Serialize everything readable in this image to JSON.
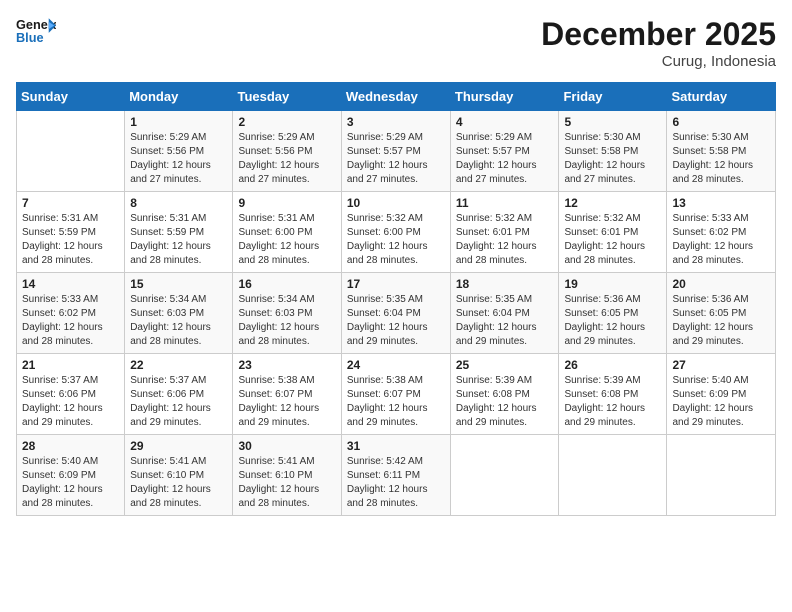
{
  "app": {
    "name": "GeneralBlue"
  },
  "header": {
    "month_year": "December 2025",
    "location": "Curug, Indonesia"
  },
  "calendar": {
    "weekdays": [
      "Sunday",
      "Monday",
      "Tuesday",
      "Wednesday",
      "Thursday",
      "Friday",
      "Saturday"
    ],
    "weeks": [
      [
        {
          "day": "",
          "content": ""
        },
        {
          "day": "1",
          "content": "Sunrise: 5:29 AM\nSunset: 5:56 PM\nDaylight: 12 hours\nand 27 minutes."
        },
        {
          "day": "2",
          "content": "Sunrise: 5:29 AM\nSunset: 5:56 PM\nDaylight: 12 hours\nand 27 minutes."
        },
        {
          "day": "3",
          "content": "Sunrise: 5:29 AM\nSunset: 5:57 PM\nDaylight: 12 hours\nand 27 minutes."
        },
        {
          "day": "4",
          "content": "Sunrise: 5:29 AM\nSunset: 5:57 PM\nDaylight: 12 hours\nand 27 minutes."
        },
        {
          "day": "5",
          "content": "Sunrise: 5:30 AM\nSunset: 5:58 PM\nDaylight: 12 hours\nand 27 minutes."
        },
        {
          "day": "6",
          "content": "Sunrise: 5:30 AM\nSunset: 5:58 PM\nDaylight: 12 hours\nand 28 minutes."
        }
      ],
      [
        {
          "day": "7",
          "content": "Sunrise: 5:31 AM\nSunset: 5:59 PM\nDaylight: 12 hours\nand 28 minutes."
        },
        {
          "day": "8",
          "content": "Sunrise: 5:31 AM\nSunset: 5:59 PM\nDaylight: 12 hours\nand 28 minutes."
        },
        {
          "day": "9",
          "content": "Sunrise: 5:31 AM\nSunset: 6:00 PM\nDaylight: 12 hours\nand 28 minutes."
        },
        {
          "day": "10",
          "content": "Sunrise: 5:32 AM\nSunset: 6:00 PM\nDaylight: 12 hours\nand 28 minutes."
        },
        {
          "day": "11",
          "content": "Sunrise: 5:32 AM\nSunset: 6:01 PM\nDaylight: 12 hours\nand 28 minutes."
        },
        {
          "day": "12",
          "content": "Sunrise: 5:32 AM\nSunset: 6:01 PM\nDaylight: 12 hours\nand 28 minutes."
        },
        {
          "day": "13",
          "content": "Sunrise: 5:33 AM\nSunset: 6:02 PM\nDaylight: 12 hours\nand 28 minutes."
        }
      ],
      [
        {
          "day": "14",
          "content": "Sunrise: 5:33 AM\nSunset: 6:02 PM\nDaylight: 12 hours\nand 28 minutes."
        },
        {
          "day": "15",
          "content": "Sunrise: 5:34 AM\nSunset: 6:03 PM\nDaylight: 12 hours\nand 28 minutes."
        },
        {
          "day": "16",
          "content": "Sunrise: 5:34 AM\nSunset: 6:03 PM\nDaylight: 12 hours\nand 28 minutes."
        },
        {
          "day": "17",
          "content": "Sunrise: 5:35 AM\nSunset: 6:04 PM\nDaylight: 12 hours\nand 29 minutes."
        },
        {
          "day": "18",
          "content": "Sunrise: 5:35 AM\nSunset: 6:04 PM\nDaylight: 12 hours\nand 29 minutes."
        },
        {
          "day": "19",
          "content": "Sunrise: 5:36 AM\nSunset: 6:05 PM\nDaylight: 12 hours\nand 29 minutes."
        },
        {
          "day": "20",
          "content": "Sunrise: 5:36 AM\nSunset: 6:05 PM\nDaylight: 12 hours\nand 29 minutes."
        }
      ],
      [
        {
          "day": "21",
          "content": "Sunrise: 5:37 AM\nSunset: 6:06 PM\nDaylight: 12 hours\nand 29 minutes."
        },
        {
          "day": "22",
          "content": "Sunrise: 5:37 AM\nSunset: 6:06 PM\nDaylight: 12 hours\nand 29 minutes."
        },
        {
          "day": "23",
          "content": "Sunrise: 5:38 AM\nSunset: 6:07 PM\nDaylight: 12 hours\nand 29 minutes."
        },
        {
          "day": "24",
          "content": "Sunrise: 5:38 AM\nSunset: 6:07 PM\nDaylight: 12 hours\nand 29 minutes."
        },
        {
          "day": "25",
          "content": "Sunrise: 5:39 AM\nSunset: 6:08 PM\nDaylight: 12 hours\nand 29 minutes."
        },
        {
          "day": "26",
          "content": "Sunrise: 5:39 AM\nSunset: 6:08 PM\nDaylight: 12 hours\nand 29 minutes."
        },
        {
          "day": "27",
          "content": "Sunrise: 5:40 AM\nSunset: 6:09 PM\nDaylight: 12 hours\nand 29 minutes."
        }
      ],
      [
        {
          "day": "28",
          "content": "Sunrise: 5:40 AM\nSunset: 6:09 PM\nDaylight: 12 hours\nand 28 minutes."
        },
        {
          "day": "29",
          "content": "Sunrise: 5:41 AM\nSunset: 6:10 PM\nDaylight: 12 hours\nand 28 minutes."
        },
        {
          "day": "30",
          "content": "Sunrise: 5:41 AM\nSunset: 6:10 PM\nDaylight: 12 hours\nand 28 minutes."
        },
        {
          "day": "31",
          "content": "Sunrise: 5:42 AM\nSunset: 6:11 PM\nDaylight: 12 hours\nand 28 minutes."
        },
        {
          "day": "",
          "content": ""
        },
        {
          "day": "",
          "content": ""
        },
        {
          "day": "",
          "content": ""
        }
      ]
    ]
  }
}
